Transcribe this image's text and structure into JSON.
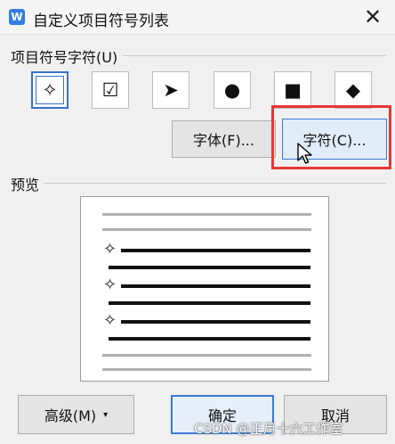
{
  "window": {
    "app_icon_letter": "W",
    "title": "自定义项目符号列表",
    "close_glyph": "✕"
  },
  "bullet_group": {
    "label": "项目符号字符(U)",
    "items": [
      {
        "glyph": "✧",
        "icon": "four-point-star-icon",
        "selected": true
      },
      {
        "glyph": "☑",
        "icon": "checkbox-icon",
        "selected": false
      },
      {
        "glyph": "➤",
        "icon": "arrowhead-icon",
        "selected": false
      },
      {
        "glyph": "●",
        "icon": "filled-circle-icon",
        "selected": false
      },
      {
        "glyph": "■",
        "icon": "filled-square-icon",
        "selected": false
      },
      {
        "glyph": "◆",
        "icon": "filled-diamond-icon",
        "selected": false
      }
    ]
  },
  "buttons": {
    "font": "字体(F)...",
    "character": "字符(C)...",
    "advanced": "高级(M)",
    "advanced_chevron": "▾",
    "ok": "确定",
    "cancel": "取消"
  },
  "preview": {
    "label": "预览",
    "bullet_glyph": "✧"
  },
  "annotation": {
    "highlight_color": "#e53935"
  },
  "watermark": {
    "text": "CSDN @正月十六工作室"
  },
  "colors": {
    "accent": "#3a6fd0",
    "app_icon": "#2f7fe6"
  }
}
